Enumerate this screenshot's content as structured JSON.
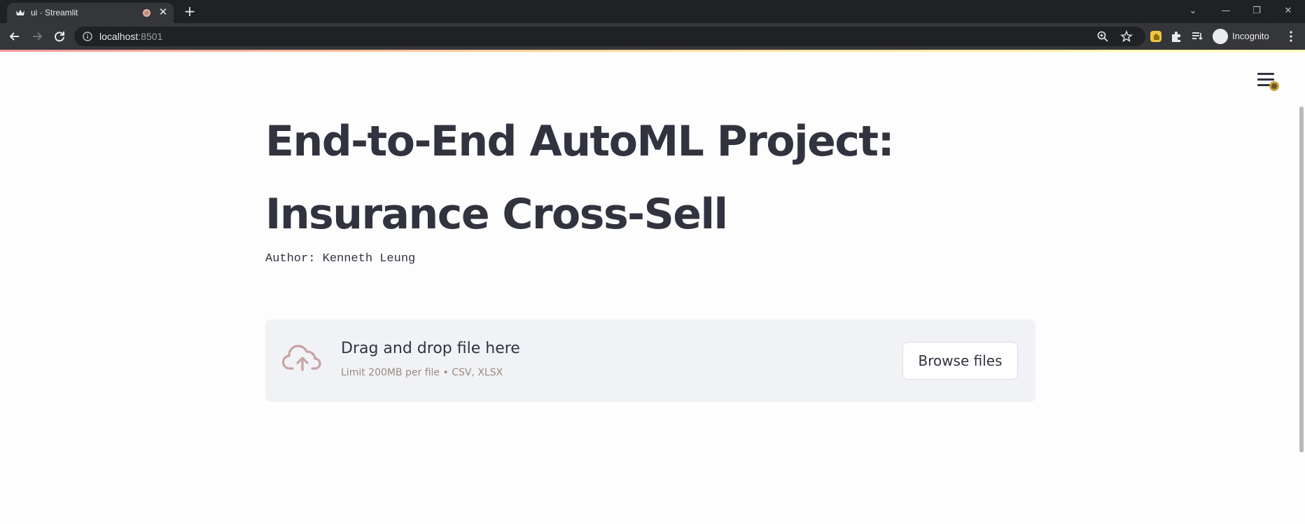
{
  "browser": {
    "tab_title": "ui · Streamlit",
    "new_tab_label": "+",
    "url_host": "localhost",
    "url_port": ":8501",
    "profile_label": "Incognito",
    "window_controls": [
      "minimize",
      "maximize",
      "close"
    ]
  },
  "page": {
    "title_line1": "End-to-End AutoML Project:",
    "title_line2": "Insurance Cross-Sell",
    "author": "Author: Kenneth Leung"
  },
  "uploader": {
    "instruction": "Drag and drop file here",
    "limit": "Limit 200MB per file • CSV, XLSX",
    "browse_label": "Browse files",
    "icon": "cloud-upload-icon"
  },
  "colors": {
    "chrome_dark": "#202124",
    "chrome_tab": "#35363a",
    "text_primary": "#31333f",
    "uploader_bg": "#f0f2f6",
    "accent_red": "#ff4b4b"
  }
}
